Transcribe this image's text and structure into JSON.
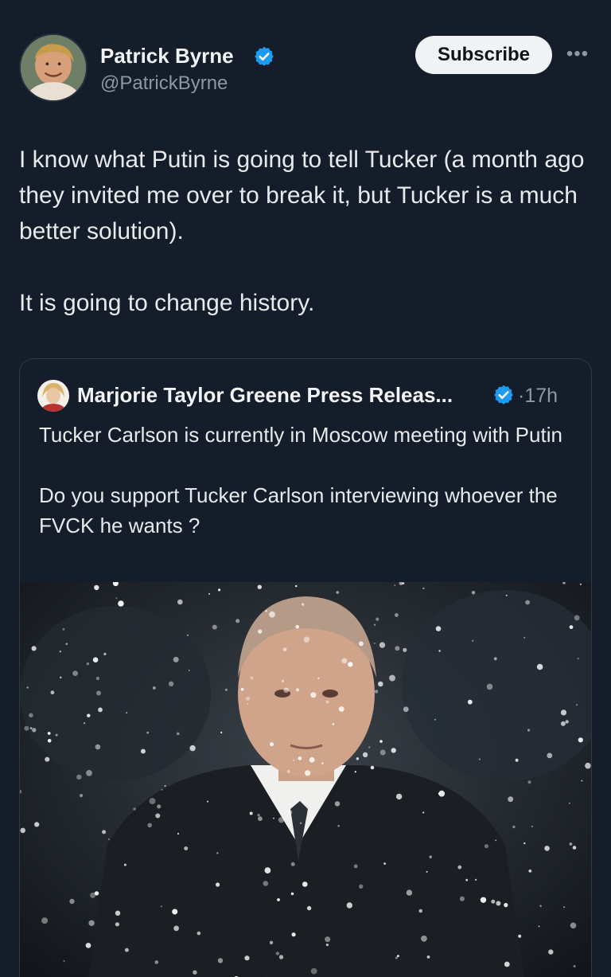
{
  "author": {
    "display_name": "Patrick Byrne",
    "handle": "@PatrickByrne",
    "verified": true
  },
  "actions": {
    "subscribe_label": "Subscribe",
    "more_label": "•••"
  },
  "tweet": {
    "paragraphs": [
      "I know what Putin is going to tell Tucker (a month ago they invited me over to break it, but Tucker is a much better solution).",
      "It is going to change history."
    ]
  },
  "quoted_tweet": {
    "display_name": "Marjorie Taylor Greene Press Releas...",
    "verified": true,
    "time": "·17h",
    "paragraphs": [
      "Tucker Carlson is currently in Moscow meeting with Putin",
      "Do you support Tucker Carlson interviewing whoever the FVCK he wants ?"
    ]
  },
  "icons": {
    "verified": "verified-badge-icon",
    "more": "more-dots-icon"
  },
  "colors": {
    "background": "#151d2a",
    "verified_blue": "#1d9bf0",
    "subscribe_bg": "#eff3f4"
  }
}
